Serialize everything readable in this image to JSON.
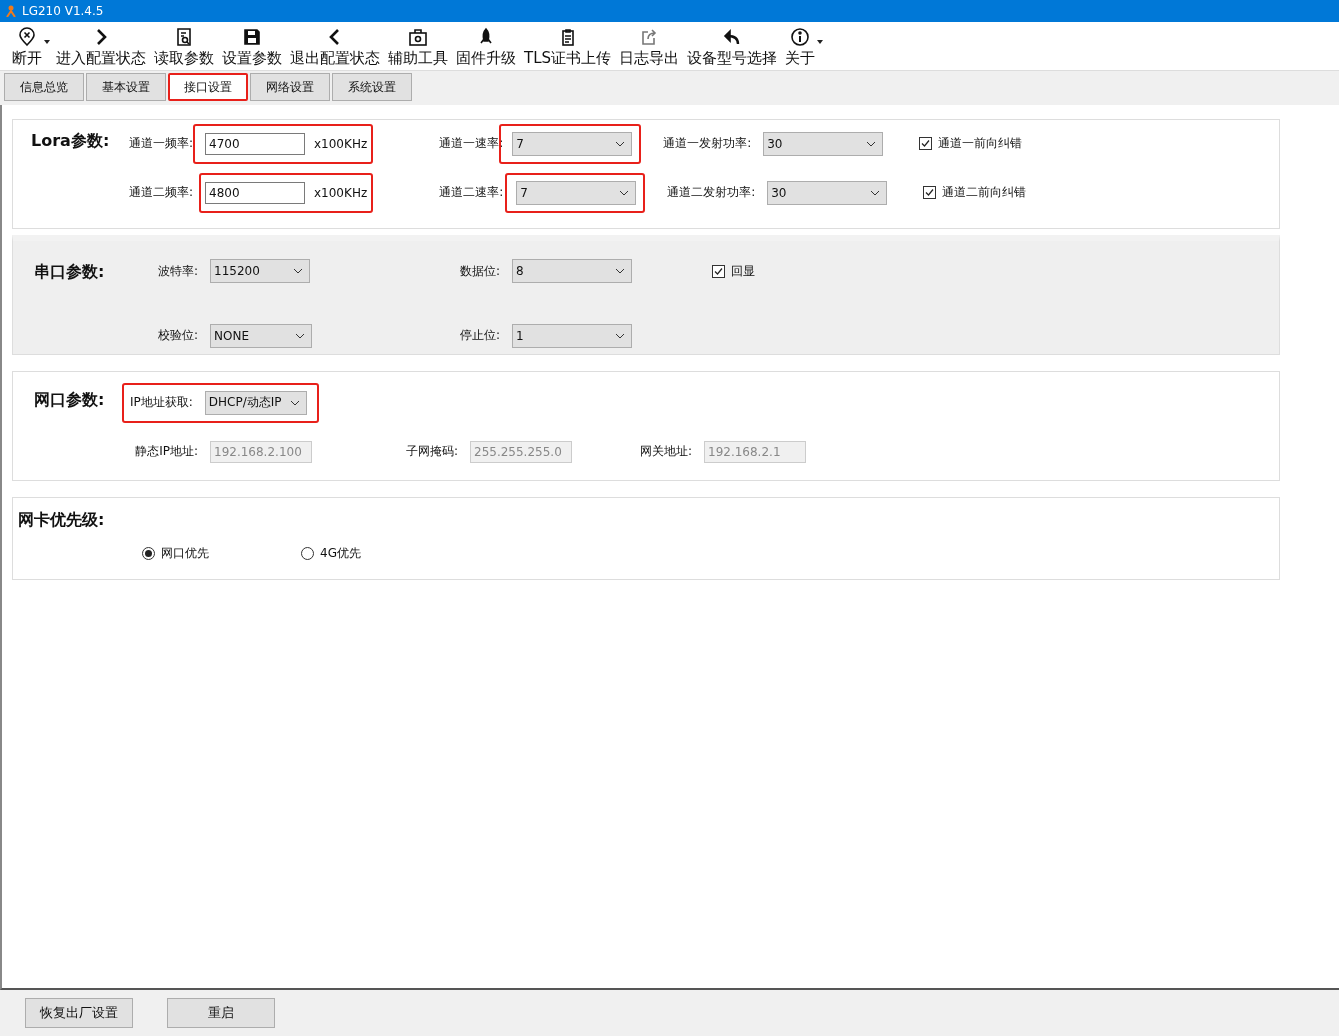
{
  "window": {
    "title": "LG210 V1.4.5"
  },
  "toolbar": [
    {
      "label": "断开",
      "dropdown": true
    },
    {
      "label": "进入配置状态",
      "dropdown": false
    },
    {
      "label": "读取参数",
      "dropdown": false
    },
    {
      "label": "设置参数",
      "dropdown": false
    },
    {
      "label": "退出配置状态",
      "dropdown": false
    },
    {
      "label": "辅助工具",
      "dropdown": false
    },
    {
      "label": "固件升级",
      "dropdown": false
    },
    {
      "label": "TLS证书上传",
      "dropdown": false
    },
    {
      "label": "日志导出",
      "dropdown": false
    },
    {
      "label": "设备型号选择",
      "dropdown": false
    },
    {
      "label": "关于",
      "dropdown": true
    }
  ],
  "tabs": [
    {
      "label": "信息总览",
      "selected": false,
      "highlighted": false
    },
    {
      "label": "基本设置",
      "selected": false,
      "highlighted": false
    },
    {
      "label": "接口设置",
      "selected": true,
      "highlighted": true
    },
    {
      "label": "网络设置",
      "selected": false,
      "highlighted": false
    },
    {
      "label": "系统设置",
      "selected": false,
      "highlighted": false
    }
  ],
  "lora": {
    "title": "Lora参数:",
    "rows": [
      {
        "freq_label": "通道一频率:",
        "freq_value": "4700",
        "unit": "x100KHz",
        "freq_highlighted": true,
        "rate_label": "通道一速率:",
        "rate_value": "7",
        "rate_highlighted": true,
        "power_label": "通道一发射功率:",
        "power_value": "30",
        "fec_label": "通道一前向纠错",
        "fec_checked": true
      },
      {
        "freq_label": "通道二频率:",
        "freq_value": "4800",
        "unit": "x100KHz",
        "freq_highlighted": true,
        "rate_label": "通道二速率:",
        "rate_value": "7",
        "rate_highlighted": true,
        "power_label": "通道二发射功率:",
        "power_value": "30",
        "fec_label": "通道二前向纠错",
        "fec_checked": true
      }
    ]
  },
  "serial": {
    "title": "串口参数:",
    "baud_label": "波特率:",
    "baud_value": "115200",
    "data_bits_label": "数据位:",
    "data_bits_value": "8",
    "echo_label": "回显",
    "echo_checked": true,
    "parity_label": "校验位:",
    "parity_value": "NONE",
    "stop_bits_label": "停止位:",
    "stop_bits_value": "1"
  },
  "network": {
    "title": "网口参数:",
    "ip_mode_label": "IP地址获取:",
    "ip_mode_value": "DHCP/动态IP",
    "ip_mode_highlighted": true,
    "static_fields": [
      {
        "label": "静态IP地址:",
        "value": "192.168.2.100",
        "disabled": true
      },
      {
        "label": "子网掩码:",
        "value": "255.255.255.0",
        "disabled": true
      },
      {
        "label": "网关地址:",
        "value": "192.168.2.1",
        "disabled": true
      }
    ]
  },
  "priority": {
    "title": "网卡优先级:",
    "options": [
      {
        "label": "网口优先",
        "selected": true
      },
      {
        "label": "4G优先",
        "selected": false
      }
    ]
  },
  "buttons": [
    "恢复出厂设置",
    "重启"
  ]
}
